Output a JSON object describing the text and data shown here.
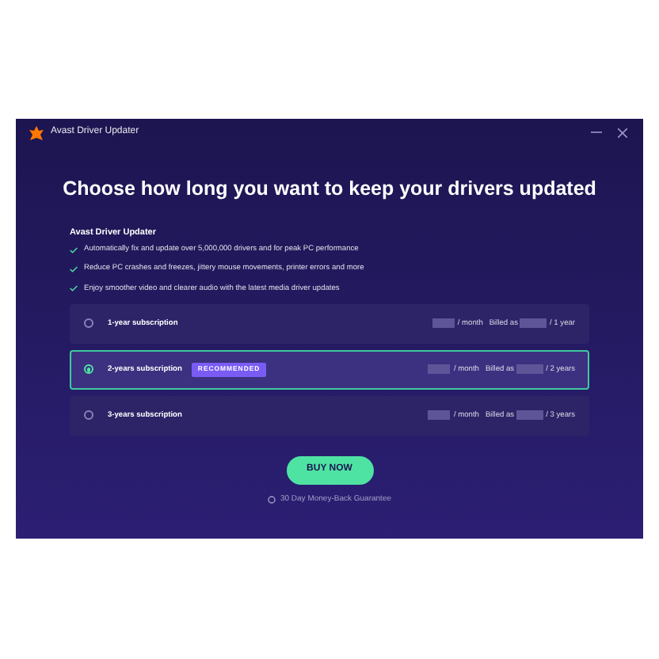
{
  "window": {
    "title": "Avast Driver Updater"
  },
  "heading": "Choose how long you want to keep your drivers updated",
  "product": "Avast Driver Updater",
  "features": [
    "Automatically fix and update over 5,000,000 drivers and for peak PC performance",
    "Reduce PC crashes and freezes, jittery mouse movements, printer errors and more",
    "Enjoy smoother video and clearer audio with the latest media driver updates"
  ],
  "plans": [
    {
      "label": "1-year subscription",
      "selected": false,
      "per_month": "/ month",
      "billed": "Billed as",
      "period": "/ 1 year"
    },
    {
      "label": "2-years subscription",
      "selected": true,
      "badge": "RECOMMENDED",
      "per_month": "/ month",
      "billed": "Billed as",
      "period": "/ 2 years"
    },
    {
      "label": "3-years subscription",
      "selected": false,
      "per_month": "/ month",
      "billed": "Billed as",
      "period": "/ 3 years"
    }
  ],
  "buy_button": "BUY NOW",
  "guarantee": "30 Day Money-Back Guarantee"
}
